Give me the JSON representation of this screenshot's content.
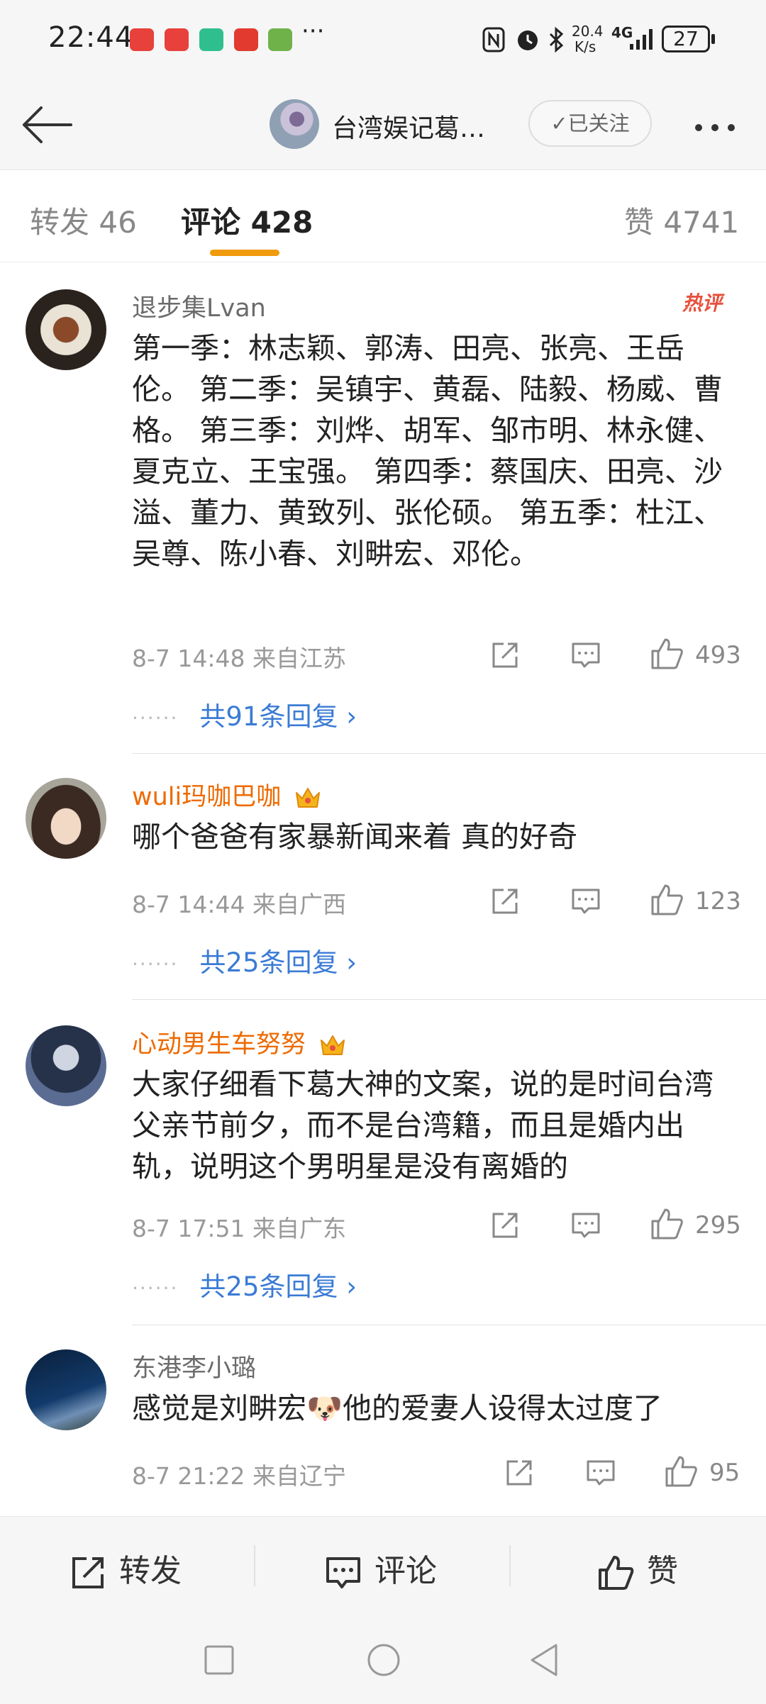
{
  "status_bar": {
    "time": "22:44",
    "network_speed": "20.4",
    "network_unit": "K/s",
    "signal": "4G",
    "battery": "27",
    "more": "···"
  },
  "nav": {
    "title": "台湾娱记葛…",
    "follow_label": "已关注"
  },
  "tabs": [
    {
      "label": "转发",
      "count": "46"
    },
    {
      "label": "评论",
      "count": "428"
    },
    {
      "label": "赞",
      "count": "4741"
    }
  ],
  "comments": [
    {
      "name": "退步集Lvan",
      "vip": false,
      "badge": "热评",
      "text": "第一季：林志颖、郭涛、田亮、张亮、王岳伦。 第二季：吴镇宇、黄磊、陆毅、杨威、曹格。 第三季：刘烨、胡军、邹市明、林永健、夏克立、王宝强。 第四季：蔡国庆、田亮、沙溢、董力、黄致列、张伦硕。 第五季：杜江、吴尊、陈小春、刘畊宏、邓伦。",
      "date": "8-7 14:48",
      "location": "来自江苏",
      "likes": "493",
      "replies": "共91条回复 ›"
    },
    {
      "name": "wuli玛咖巴咖",
      "vip": true,
      "text": "哪个爸爸有家暴新闻来着 真的好奇",
      "date": "8-7 14:44",
      "location": "来自广西",
      "likes": "123",
      "replies": "共25条回复 ›"
    },
    {
      "name": "心动男生车努努",
      "vip": true,
      "text": "大家仔细看下葛大神的文案，说的是时间台湾父亲节前夕，而不是台湾籍，而且是婚内出轨，说明这个男明星是没有离婚的",
      "date": "8-7 17:51",
      "location": "来自广东",
      "likes": "295",
      "replies": "共25条回复 ›"
    },
    {
      "name": "东港李小璐",
      "vip": false,
      "text_before": "感觉是刘畊宏",
      "emoji": "🐶",
      "text_after": "他的爱妻人设得太过度了",
      "date": "8-7 21:22",
      "location": "来自辽宁",
      "likes": "95"
    }
  ],
  "bottom_bar": {
    "repost": "转发",
    "comment": "评论",
    "like": "赞"
  },
  "colors": {
    "accent": "#f09a0d",
    "link": "#3a7bd5",
    "vip_name": "#ee6a00",
    "hot_badge": "#e8503e"
  }
}
